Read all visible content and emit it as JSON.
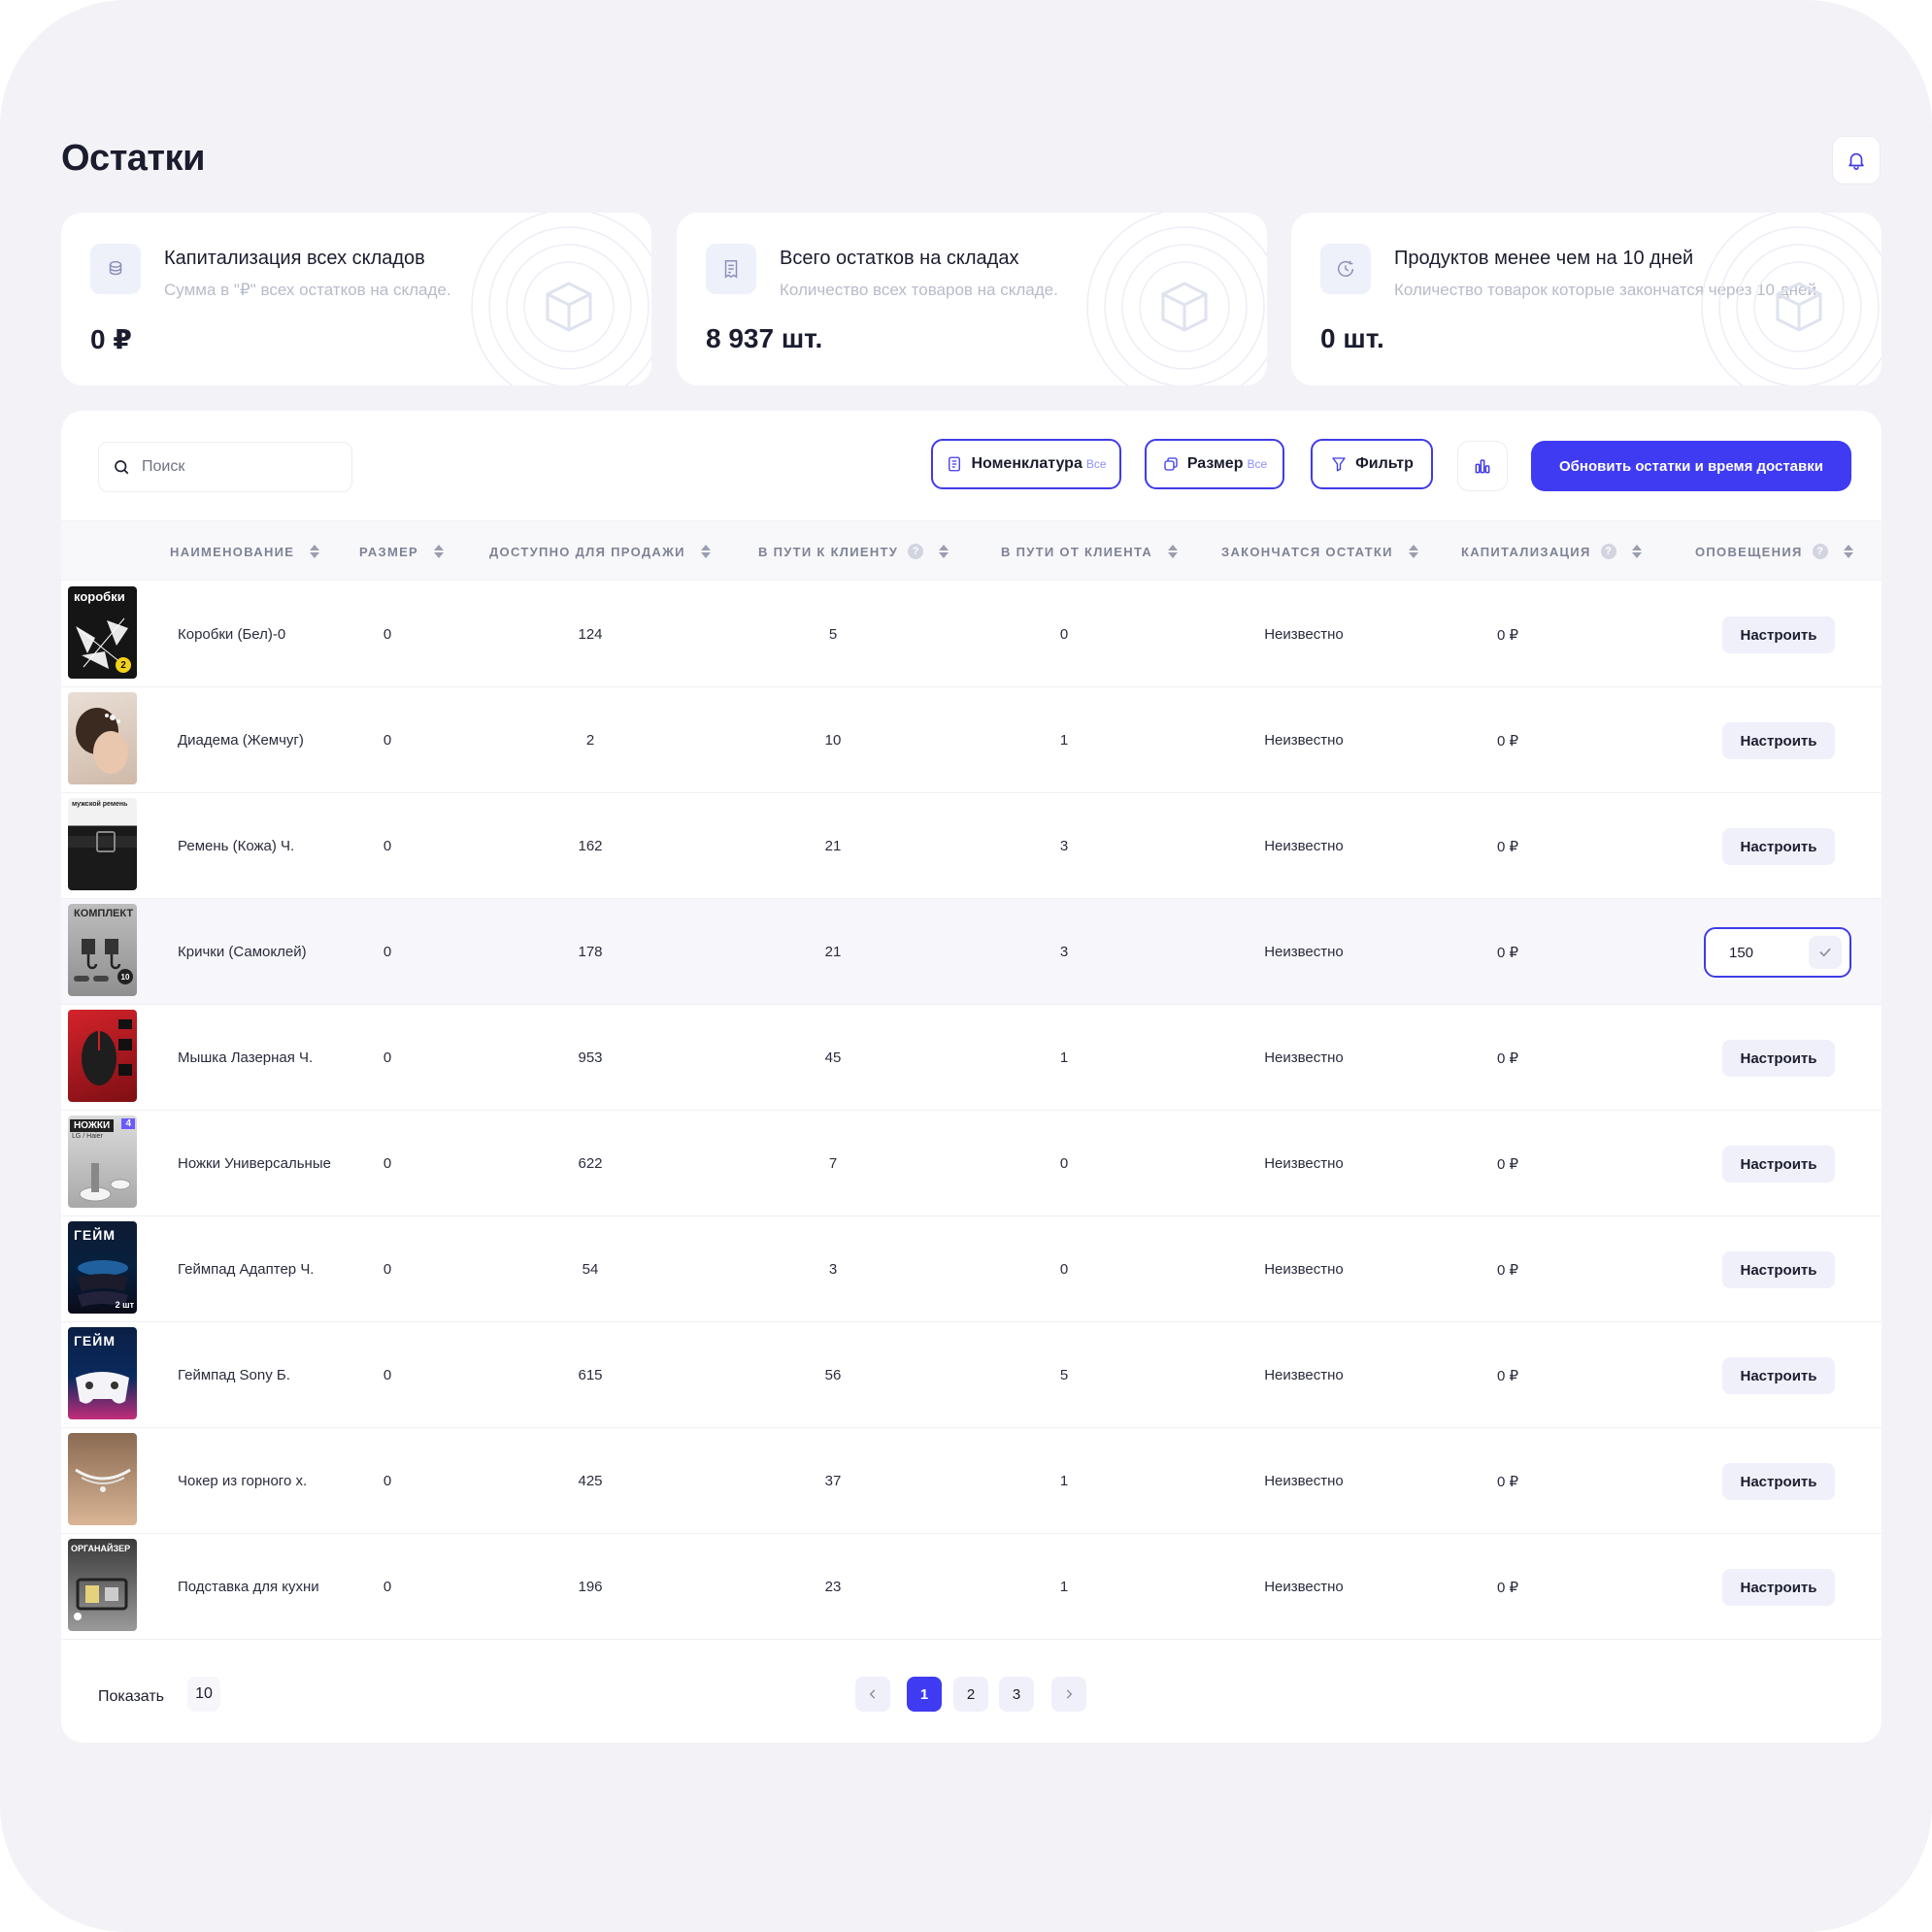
{
  "page": {
    "title": "Остатки"
  },
  "cards": [
    {
      "title": "Капитализация всех складов",
      "subtitle": "Сумма в \"₽\" всех остатков на складе.",
      "value": "0 ₽"
    },
    {
      "title": "Всего остатков на складах",
      "subtitle": "Количество всех товаров на складе.",
      "value": "8 937 шт."
    },
    {
      "title": "Продуктов менее чем на 10 дней",
      "subtitle": "Количество товарок которые закончатся через 10 дней.",
      "value": "0 шт."
    }
  ],
  "toolbar": {
    "search_placeholder": "Поиск",
    "nomenclature_label": "Номенклатура",
    "nomenclature_hint": "Все",
    "size_label": "Размер",
    "size_hint": "Все",
    "filter_label": "Фильтр",
    "update_label": "Обновить остатки и время доставки"
  },
  "columns": [
    "НАИМЕНОВАНИЕ",
    "РАЗМЕР",
    "ДОСТУПНО ДЛЯ ПРОДАЖИ",
    "В ПУТИ К КЛИЕНТУ",
    "В ПУТИ ОТ КЛИЕНТА",
    "ЗАКОНЧАТСЯ ОСТАТКИ",
    "КАПИТАЛИЗАЦИЯ",
    "ОПОВЕЩЕНИЯ"
  ],
  "help_mark": "?",
  "configure_label": "Настроить",
  "rows": [
    {
      "name": "Коробки (Бел)-0",
      "size": "0",
      "available": "124",
      "to_client": "5",
      "from_client": "0",
      "runs_out": "Неизвестно",
      "capitalization": "0 ₽",
      "thumb_text": "коробки",
      "thumb_badge": "2"
    },
    {
      "name": "Диадема (Жемчуг)",
      "size": "0",
      "available": "2",
      "to_client": "10",
      "from_client": "1",
      "runs_out": "Неизвестно",
      "capitalization": "0 ₽",
      "thumb_text": ""
    },
    {
      "name": "Ремень (Кожа) Ч.",
      "size": "0",
      "available": "162",
      "to_client": "21",
      "from_client": "3",
      "runs_out": "Неизвестно",
      "capitalization": "0 ₽",
      "thumb_text": "мужской ремень"
    },
    {
      "name": "Крички (Самоклей)",
      "size": "0",
      "available": "178",
      "to_client": "21",
      "from_client": "3",
      "runs_out": "Неизвестно",
      "capitalization": "0 ₽",
      "thumb_text": "КОМПЛЕКТ",
      "thumb_badge": "10",
      "alert_value": "150"
    },
    {
      "name": "Мышка Лазерная Ч.",
      "size": "0",
      "available": "953",
      "to_client": "45",
      "from_client": "1",
      "runs_out": "Неизвестно",
      "capitalization": "0 ₽",
      "thumb_text": ""
    },
    {
      "name": "Ножки Универсальные",
      "size": "0",
      "available": "622",
      "to_client": "7",
      "from_client": "0",
      "runs_out": "Неизвестно",
      "capitalization": "0 ₽",
      "thumb_text": "НОЖКИ",
      "thumb_badge": "4",
      "thumb_sub": "LG / Haier"
    },
    {
      "name": "Геймпад Адаптер Ч.",
      "size": "0",
      "available": "54",
      "to_client": "3",
      "from_client": "0",
      "runs_out": "Неизвестно",
      "capitalization": "0 ₽",
      "thumb_text": "ГЕЙМ",
      "thumb_badge": "2 шт"
    },
    {
      "name": "Геймпад Sony Б.",
      "size": "0",
      "available": "615",
      "to_client": "56",
      "from_client": "5",
      "runs_out": "Неизвестно",
      "capitalization": "0 ₽",
      "thumb_text": "ГЕЙМ"
    },
    {
      "name": "Чокер из горного х.",
      "size": "0",
      "available": "425",
      "to_client": "37",
      "from_client": "1",
      "runs_out": "Неизвестно",
      "capitalization": "0 ₽",
      "thumb_text": ""
    },
    {
      "name": "Подставка для кухни",
      "size": "0",
      "available": "196",
      "to_client": "23",
      "from_client": "1",
      "runs_out": "Неизвестно",
      "capitalization": "0 ₽",
      "thumb_text": "ОРГАНАЙЗЕР"
    }
  ],
  "footer": {
    "show_label": "Показать",
    "show_value": "10",
    "pages": [
      "1",
      "2",
      "3"
    ],
    "current_page": "1"
  },
  "colors": {
    "accent": "#3f3bf2",
    "background": "#f3f3f7",
    "card": "#ffffff",
    "muted": "#b8bbc9"
  },
  "icons": [
    "bell-icon",
    "coins-icon",
    "receipt-icon",
    "clock-refresh-icon",
    "box-icon",
    "search-icon",
    "document-icon",
    "copy-icon",
    "filter-icon",
    "bar-chart-icon",
    "sort-icon",
    "help-icon",
    "check-icon",
    "chevron-left-icon",
    "chevron-right-icon"
  ]
}
